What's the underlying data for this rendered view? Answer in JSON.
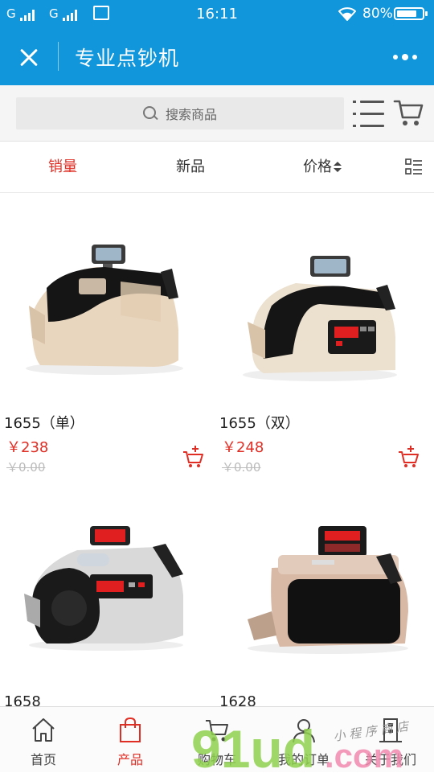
{
  "status_bar": {
    "sim1": "G",
    "sim2": "G",
    "time": "16:11",
    "battery_percent": "80%",
    "battery_level": 0.8,
    "icons": [
      "signal-icon",
      "sim-card-icon",
      "wifi-icon",
      "battery-icon"
    ]
  },
  "title_bar": {
    "title": "专业点钞机",
    "close_icon": "close-icon",
    "more_icon": "more-dots-icon"
  },
  "search": {
    "placeholder": "搜索商品",
    "icons": [
      "search-icon",
      "list-icon",
      "cart-icon"
    ]
  },
  "sort_tabs": [
    {
      "label": "销量",
      "active": true
    },
    {
      "label": "新品",
      "active": false
    },
    {
      "label": "价格",
      "active": false,
      "icon": "sort-arrows-icon"
    }
  ],
  "products": [
    {
      "name": "1655（单）",
      "price": "￥238",
      "original_price": "￥0.00"
    },
    {
      "name": "1655（双）",
      "price": "￥248",
      "original_price": "￥0.00"
    },
    {
      "name": "1658",
      "price": "",
      "original_price": ""
    },
    {
      "name": "1628",
      "price": "",
      "original_price": ""
    }
  ],
  "bottom_nav": [
    {
      "label": "首页",
      "icon": "home-icon",
      "active": false
    },
    {
      "label": "产品",
      "icon": "bag-icon",
      "active": true
    },
    {
      "label": "购物车",
      "icon": "cart-icon",
      "active": false
    },
    {
      "label": "我的订单",
      "icon": "user-icon",
      "active": false
    },
    {
      "label": "关于我们",
      "icon": "building-icon",
      "active": false
    }
  ],
  "watermark": {
    "text": "91ud.com",
    "handwriting": "小程序商店"
  },
  "colors": {
    "brand_blue": "#1296db",
    "accent_red": "#e02e24",
    "watermark_green": "#8fd14f",
    "watermark_pink": "#f28ab0"
  }
}
